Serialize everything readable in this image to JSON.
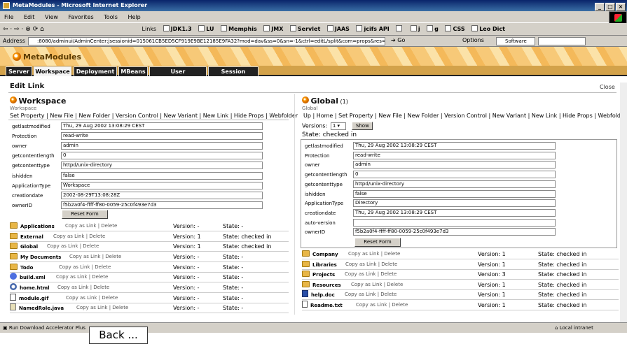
{
  "window": {
    "title": "MetaModules - Microsoft Internet Explorer",
    "buttons": [
      "_",
      "□",
      "×"
    ]
  },
  "menu": [
    "File",
    "Edit",
    "View",
    "Favorites",
    "Tools",
    "Help"
  ],
  "toolbar": {
    "nav_icons": [
      "back-icon",
      "forward-icon",
      "stop-icon",
      "refresh-icon",
      "home-icon"
    ],
    "links_label": "Links",
    "links": [
      "JDK1.3",
      "LU",
      "Memphis",
      "JMX",
      "Servlet",
      "JAAS",
      "jcifs API",
      "",
      "j",
      "g",
      "CSS",
      "Leo Dict"
    ]
  },
  "address": {
    "label": "Address",
    "url": ":8080/adminui/AdminCenter;jsessionid=015061CB5ED5CF919E9BE12185E9FA32?mod=dav&ss=0&sn=-1&ctrl=editL/split&com=props&res=Global",
    "go": "Go",
    "options": "Options",
    "software": "Software"
  },
  "brand": {
    "name": "MetaModules"
  },
  "tabs": [
    "Server",
    "Workspace",
    "Deployment",
    "MBeans",
    "User Management",
    "Session Monitor"
  ],
  "active_tab": "Workspace",
  "page": {
    "title": "Edit Link",
    "close": "Close"
  },
  "left": {
    "title": "Workspace",
    "subtitle": "Workspace",
    "actions": "Set Property | New File | New Folder | Version Control | New Variant | New Link | Hide Props | Webfolder",
    "props": [
      {
        "k": "getlastmodified",
        "v": "Thu, 29 Aug 2002 13:08:29 CEST"
      },
      {
        "k": "Protection",
        "v": "read-write"
      },
      {
        "k": "owner",
        "v": "admin"
      },
      {
        "k": "getcontentlength",
        "v": "0"
      },
      {
        "k": "getcontenttype",
        "v": "httpd/unix-directory"
      },
      {
        "k": "ishidden",
        "v": "false"
      },
      {
        "k": "ApplicationType",
        "v": "Workspace"
      },
      {
        "k": "creationdate",
        "v": "2002-08-29T13:08:28Z"
      },
      {
        "k": "ownerID",
        "v": "f5b2a0f4-ffff-ff80-0059-25c0f493e7d3"
      }
    ],
    "reset": "Reset Form",
    "items": [
      {
        "name": "Applications",
        "links": "Copy as Link | Delete",
        "version": "Version: -",
        "state": "State: -",
        "icon": "folder"
      },
      {
        "name": "External",
        "links": "Copy as Link | Delete",
        "version": "Version: 1",
        "state": "State: checked in",
        "icon": "folder"
      },
      {
        "name": "Global",
        "links": "Copy as Link | Delete",
        "version": "Version: 1",
        "state": "State: checked in",
        "icon": "folder"
      },
      {
        "name": "My Documents",
        "links": "Copy as Link | Delete",
        "version": "Version: -",
        "state": "State: -",
        "icon": "folder"
      },
      {
        "name": "Todo",
        "links": "Copy as Link | Delete",
        "version": "Version: -",
        "state": "State: -",
        "icon": "folder"
      },
      {
        "name": "build.xml",
        "links": "Copy as Link | Delete",
        "version": "Version: -",
        "state": "State: -",
        "icon": "xml"
      },
      {
        "name": "home.html",
        "links": "Copy as Link | Delete",
        "version": "Version: -",
        "state": "State: -",
        "icon": "web"
      },
      {
        "name": "module.gif",
        "links": "Copy as Link | Delete",
        "version": "Version: -",
        "state": "State: -",
        "icon": "img"
      },
      {
        "name": "NamedRole.java",
        "links": "Copy as Link | Delete",
        "version": "Version: -",
        "state": "State: -",
        "icon": "java"
      }
    ]
  },
  "right": {
    "title": "Global",
    "count": "(1)",
    "subtitle": "Global",
    "actions": "Up | Home | Set Property | New File | New Folder | Version Control | New Variant | New Link | Hide Props | Webfolder",
    "versions_label": "Versions:",
    "versions_value": "1",
    "show": "Show",
    "state": "State: checked in",
    "props": [
      {
        "k": "getlastmodified",
        "v": "Thu, 29 Aug 2002 13:08:29 CEST"
      },
      {
        "k": "Protection",
        "v": "read-write"
      },
      {
        "k": "owner",
        "v": "admin"
      },
      {
        "k": "getcontentlength",
        "v": "0"
      },
      {
        "k": "getcontenttype",
        "v": "httpd/unix-directory"
      },
      {
        "k": "ishidden",
        "v": "false"
      },
      {
        "k": "ApplicationType",
        "v": "Directory"
      },
      {
        "k": "creationdate",
        "v": "Thu, 29 Aug 2002 13:08:29 CEST"
      },
      {
        "k": "auto-version",
        "v": ""
      },
      {
        "k": "ownerID",
        "v": "f5b2a0f4-ffff-ff80-0059-25c0f493e7d3"
      }
    ],
    "reset": "Reset Form",
    "items": [
      {
        "name": "Company",
        "links": "Copy as Link | Delete",
        "version": "Version: 1",
        "state": "State: checked in",
        "icon": "folder"
      },
      {
        "name": "Libraries",
        "links": "Copy as Link | Delete",
        "version": "Version: 1",
        "state": "State: checked in",
        "icon": "folder"
      },
      {
        "name": "Projects",
        "links": "Copy as Link | Delete",
        "version": "Version: 3",
        "state": "State: checked in",
        "icon": "folder"
      },
      {
        "name": "Resources",
        "links": "Copy as Link | Delete",
        "version": "Version: 1",
        "state": "State: checked in",
        "icon": "folder"
      },
      {
        "name": "help.doc",
        "links": "Copy as Link | Delete",
        "version": "Version: 1",
        "state": "State: checked in",
        "icon": "word"
      },
      {
        "name": "Readme.txt",
        "links": "Copy as Link | Delete",
        "version": "Version: 1",
        "state": "State: checked in",
        "icon": "file"
      }
    ]
  },
  "status": {
    "left": "Run Download Accelerator Plus",
    "right": "Local intranet"
  },
  "back_button": "Back ..."
}
